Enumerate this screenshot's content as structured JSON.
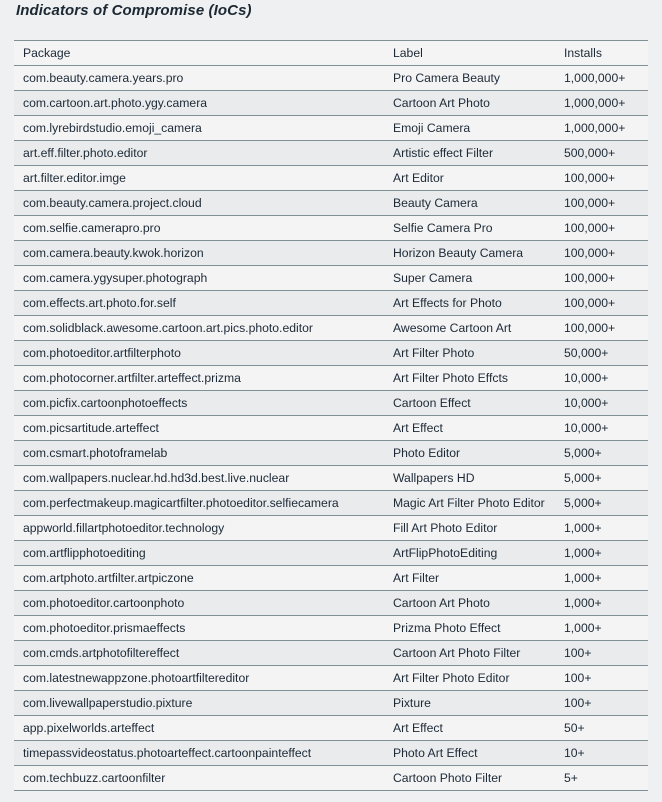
{
  "section": {
    "title": "Indicators of Compromise (IoCs)"
  },
  "table": {
    "columns": [
      {
        "key": "package",
        "header": "Package"
      },
      {
        "key": "label",
        "header": "Label"
      },
      {
        "key": "installs",
        "header": "Installs"
      }
    ],
    "rows": [
      {
        "package": "com.beauty.camera.years.pro",
        "label": "Pro Camera Beauty",
        "installs": "1,000,000+"
      },
      {
        "package": "com.cartoon.art.photo.ygy.camera",
        "label": "Cartoon Art Photo",
        "installs": "1,000,000+"
      },
      {
        "package": "com.lyrebirdstudio.emoji_camera",
        "label": "Emoji Camera",
        "installs": "1,000,000+"
      },
      {
        "package": "art.eff.filter.photo.editor",
        "label": "Artistic effect Filter",
        "installs": "500,000+"
      },
      {
        "package": "art.filter.editor.imge",
        "label": "Art Editor",
        "installs": "100,000+"
      },
      {
        "package": "com.beauty.camera.project.cloud",
        "label": "Beauty Camera",
        "installs": "100,000+"
      },
      {
        "package": "com.selfie.camerapro.pro",
        "label": "Selfie Camera Pro",
        "installs": "100,000+"
      },
      {
        "package": "com.camera.beauty.kwok.horizon",
        "label": "Horizon Beauty Camera",
        "installs": "100,000+"
      },
      {
        "package": "com.camera.ygysuper.photograph",
        "label": "Super Camera",
        "installs": "100,000+"
      },
      {
        "package": "com.effects.art.photo.for.self",
        "label": "Art Effects for Photo",
        "installs": "100,000+"
      },
      {
        "package": "com.solidblack.awesome.cartoon.art.pics.photo.editor",
        "label": "Awesome Cartoon Art",
        "installs": "100,000+"
      },
      {
        "package": "com.photoeditor.artfilterphoto",
        "label": "Art Filter Photo",
        "installs": "50,000+"
      },
      {
        "package": "com.photocorner.artfilter.arteffect.prizma",
        "label": "Art Filter Photo Effcts",
        "installs": "10,000+"
      },
      {
        "package": "com.picfix.cartoonphotoeffects",
        "label": "Cartoon Effect",
        "installs": "10,000+"
      },
      {
        "package": "com.picsartitude.arteffect",
        "label": "Art Effect",
        "installs": "10,000+"
      },
      {
        "package": "com.csmart.photoframelab",
        "label": "Photo Editor",
        "installs": "5,000+"
      },
      {
        "package": "com.wallpapers.nuclear.hd.hd3d.best.live.nuclear",
        "label": "Wallpapers HD",
        "installs": "5,000+"
      },
      {
        "package": "com.perfectmakeup.magicartfilter.photoeditor.selfiecamera",
        "label": "Magic Art Filter Photo Editor",
        "installs": "5,000+"
      },
      {
        "package": "appworld.fillartphotoeditor.technology",
        "label": "Fill Art Photo Editor",
        "installs": "1,000+"
      },
      {
        "package": "com.artflipphotoediting",
        "label": "ArtFlipPhotoEditing",
        "installs": "1,000+"
      },
      {
        "package": "com.artphoto.artfilter.artpiczone",
        "label": "Art Filter",
        "installs": "1,000+"
      },
      {
        "package": "com.photoeditor.cartoonphoto",
        "label": "Cartoon Art Photo",
        "installs": "1,000+"
      },
      {
        "package": "com.photoeditor.prismaeffects",
        "label": "Prizma Photo Effect",
        "installs": "1,000+"
      },
      {
        "package": "com.cmds.artphotofiltereffect",
        "label": "Cartoon Art Photo Filter",
        "installs": "100+"
      },
      {
        "package": "com.latestnewappzone.photoartfiltereditor",
        "label": "Art Filter Photo Editor",
        "installs": "100+"
      },
      {
        "package": "com.livewallpaperstudio.pixture",
        "label": "Pixture",
        "installs": "100+"
      },
      {
        "package": "app.pixelworlds.arteffect",
        "label": "Art Effect",
        "installs": "50+"
      },
      {
        "package": "timepassvideostatus.photoarteffect.cartoonpainteffect",
        "label": "Photo Art Effect",
        "installs": "10+"
      },
      {
        "package": "com.techbuzz.cartoonfilter",
        "label": "Cartoon Photo Filter",
        "installs": "5+"
      }
    ]
  },
  "colors": {
    "page_background": "#eef0f1",
    "row_odd_background": "#f4f4f5",
    "row_even_background": "#e9ebed",
    "border": "#7f9097",
    "text": "#1d2a36"
  }
}
